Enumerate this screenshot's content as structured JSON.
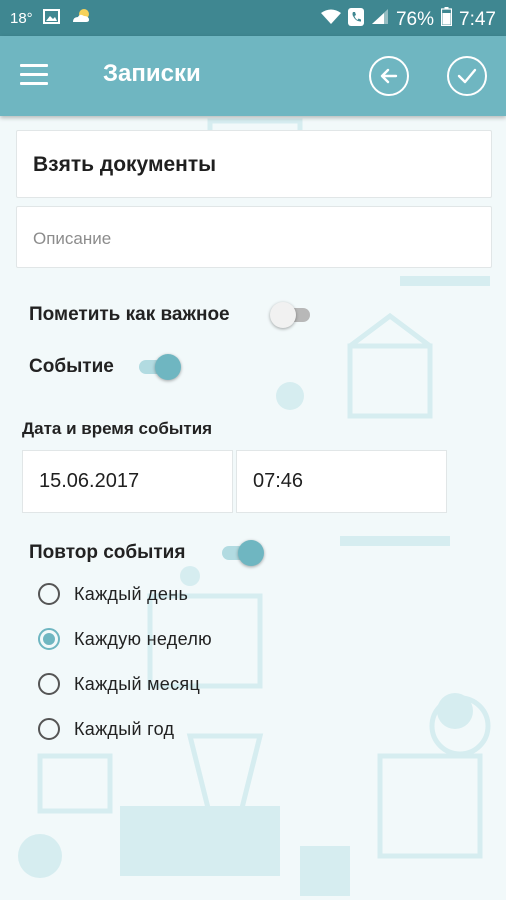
{
  "status_bar": {
    "temperature": "18°",
    "battery": "76%",
    "time": "7:47",
    "icons": [
      "image-icon",
      "weather-icon",
      "wifi-icon",
      "call-icon",
      "signal-icon",
      "battery-icon"
    ]
  },
  "app_bar": {
    "title": "Записки",
    "menu_icon": "hamburger-icon",
    "back_icon": "arrow-left-circle-icon",
    "confirm_icon": "check-circle-icon"
  },
  "form": {
    "title_value": "Взять документы",
    "description_placeholder": "Описание",
    "important_label": "Пометить как важное",
    "important_on": false,
    "event_label": "Событие",
    "event_on": true,
    "datetime_label": "Дата и время события",
    "date_value": "15.06.2017",
    "time_value": "07:46",
    "repeat_label": "Повтор события",
    "repeat_on": true,
    "repeat_options": [
      {
        "label": "Каждый день",
        "checked": false
      },
      {
        "label": "Каждую неделю",
        "checked": true
      },
      {
        "label": "Каждый месяц",
        "checked": false
      },
      {
        "label": "Каждый год",
        "checked": false
      }
    ]
  },
  "colors": {
    "status_bar": "#3f8791",
    "accent": "#6fb6c1",
    "background": "#f2f9fa",
    "pattern": "#d7eef1"
  }
}
